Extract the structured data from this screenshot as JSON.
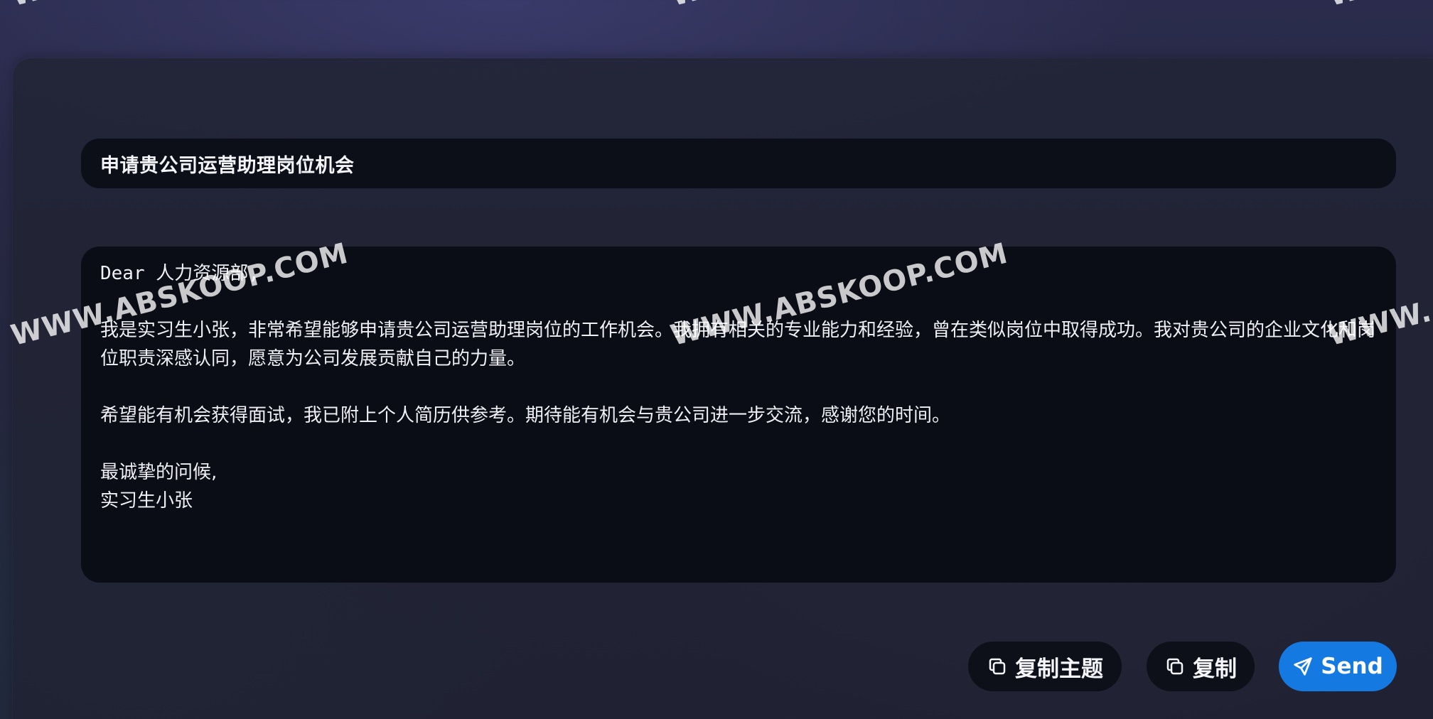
{
  "email": {
    "subject": "申请贵公司运营助理岗位机会",
    "body": {
      "greeting": "Dear 人力资源部,",
      "paragraph1": "我是实习生小张，非常希望能够申请贵公司运营助理岗位的工作机会。我拥有相关的专业能力和经验，曾在类似岗位中取得成功。我对贵公司的企业文化和岗位职责深感认同，愿意为公司发展贡献自己的力量。",
      "paragraph2": "希望能有机会获得面试，我已附上个人简历供参考。期待能有机会与贵公司进一步交流，感谢您的时间。",
      "closing": "最诚挚的问候,",
      "signature": "实习生小张"
    }
  },
  "actions": {
    "copy_subject_label": "复制主题",
    "copy_label": "复制",
    "send_label": "Send"
  },
  "watermark": {
    "text": "WWW.ABSKOOP.COM",
    "partial": "WWW."
  },
  "colors": {
    "primary": "#1479e0",
    "field_bg": "#0a0d15",
    "page_bg": "#262741"
  },
  "icons": {
    "copy": "copy-icon",
    "send": "send-icon"
  }
}
